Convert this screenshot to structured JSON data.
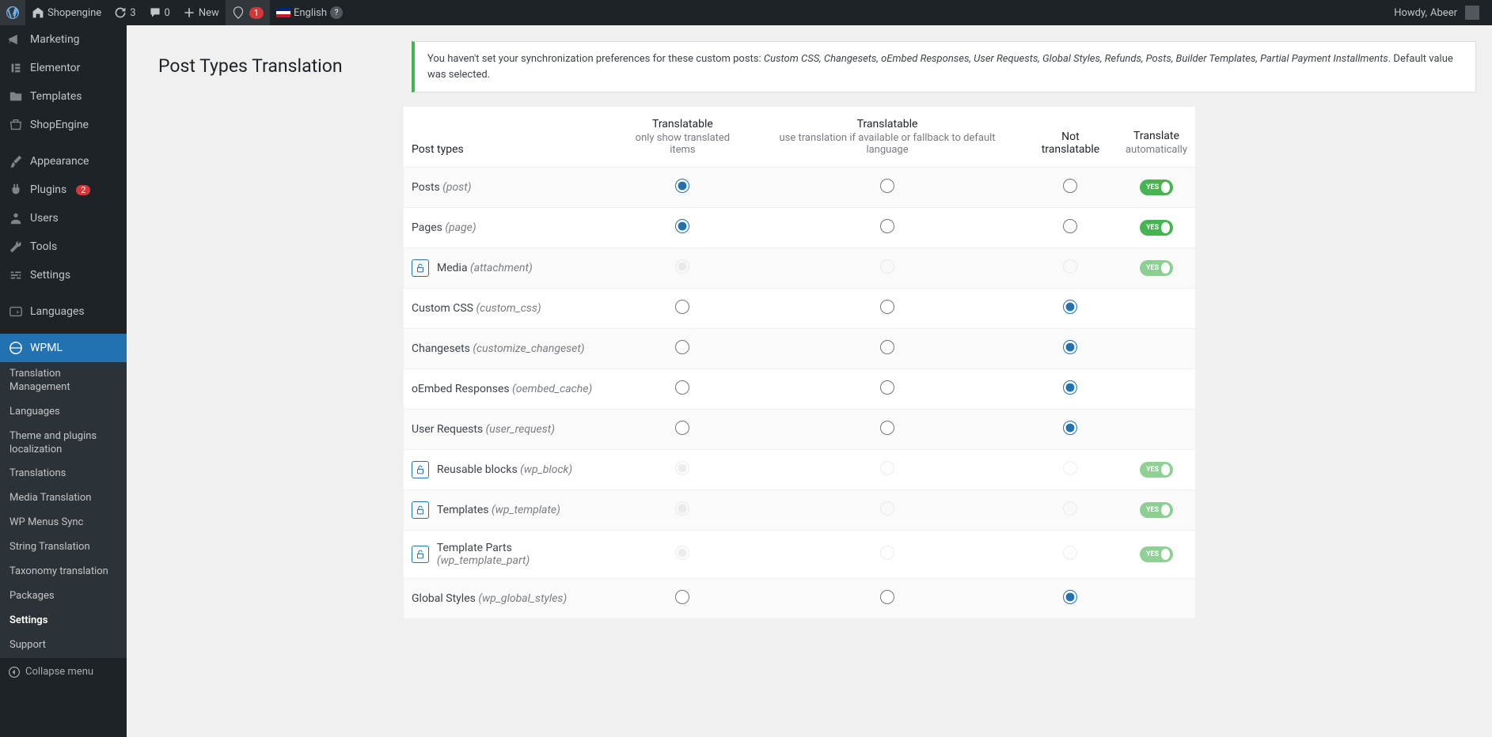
{
  "adminbar": {
    "site_name": "Shopengine",
    "refresh_count": "3",
    "comments_count": "0",
    "new_label": "New",
    "notification_count": "1",
    "language_label": "English",
    "howdy_prefix": "Howdy, ",
    "howdy_user": "Abeer"
  },
  "sidebar": {
    "items": [
      {
        "label": "Marketing",
        "icon": "megaphone"
      },
      {
        "label": "Elementor",
        "icon": "elementor"
      },
      {
        "label": "Templates",
        "icon": "folder"
      },
      {
        "label": "ShopEngine",
        "icon": "shopengine"
      },
      {
        "label": "Appearance",
        "icon": "brush"
      },
      {
        "label": "Plugins",
        "icon": "plug",
        "badge": "2"
      },
      {
        "label": "Users",
        "icon": "user"
      },
      {
        "label": "Tools",
        "icon": "wrench"
      },
      {
        "label": "Settings",
        "icon": "sliders"
      },
      {
        "label": "Languages",
        "icon": "lang"
      },
      {
        "label": "WPML",
        "icon": "wpml",
        "current": true
      }
    ],
    "wpml_sub": [
      {
        "label": "Translation Management"
      },
      {
        "label": "Languages"
      },
      {
        "label": "Theme and plugins localization"
      },
      {
        "label": "Translations"
      },
      {
        "label": "Media Translation"
      },
      {
        "label": "WP Menus Sync"
      },
      {
        "label": "String Translation"
      },
      {
        "label": "Taxonomy translation"
      },
      {
        "label": "Packages"
      },
      {
        "label": "Settings",
        "active": true
      },
      {
        "label": "Support"
      }
    ],
    "collapse_label": "Collapse menu"
  },
  "page": {
    "title": "Post Types Translation",
    "notice_prefix": "You haven't set your synchronization preferences for these custom posts: ",
    "notice_items": "Custom CSS, Changesets, oEmbed Responses, User Requests, Global Styles, Refunds, Posts, Builder Templates, Partial Payment Installments",
    "notice_suffix": ". Default value was selected."
  },
  "columns": {
    "c1": "Post types",
    "c2_top": "Translatable",
    "c2_sub": "only show translated items",
    "c3_top": "Translatable",
    "c3_sub": "use translation if available or fallback to default language",
    "c4": "Not translatable",
    "c5_top": "Translate",
    "c5_sub": "automatically"
  },
  "toggle_label": "YES",
  "rows": [
    {
      "name": "Posts",
      "slug": "post",
      "selected": 0,
      "locked": false,
      "toggle": true
    },
    {
      "name": "Pages",
      "slug": "page",
      "selected": 0,
      "locked": false,
      "toggle": true
    },
    {
      "name": "Media",
      "slug": "attachment",
      "selected": 0,
      "locked": true,
      "toggle": true
    },
    {
      "name": "Custom CSS",
      "slug": "custom_css",
      "selected": 2,
      "locked": false,
      "toggle": false
    },
    {
      "name": "Changesets",
      "slug": "customize_changeset",
      "selected": 2,
      "locked": false,
      "toggle": false
    },
    {
      "name": "oEmbed Responses",
      "slug": "oembed_cache",
      "selected": 2,
      "locked": false,
      "toggle": false
    },
    {
      "name": "User Requests",
      "slug": "user_request",
      "selected": 2,
      "locked": false,
      "toggle": false
    },
    {
      "name": "Reusable blocks",
      "slug": "wp_block",
      "selected": 0,
      "locked": true,
      "toggle": true
    },
    {
      "name": "Templates",
      "slug": "wp_template",
      "selected": 0,
      "locked": true,
      "toggle": true
    },
    {
      "name": "Template Parts",
      "slug": "wp_template_part",
      "selected": 0,
      "locked": true,
      "toggle": true
    },
    {
      "name": "Global Styles",
      "slug": "wp_global_styles",
      "selected": 2,
      "locked": false,
      "toggle": false
    }
  ]
}
